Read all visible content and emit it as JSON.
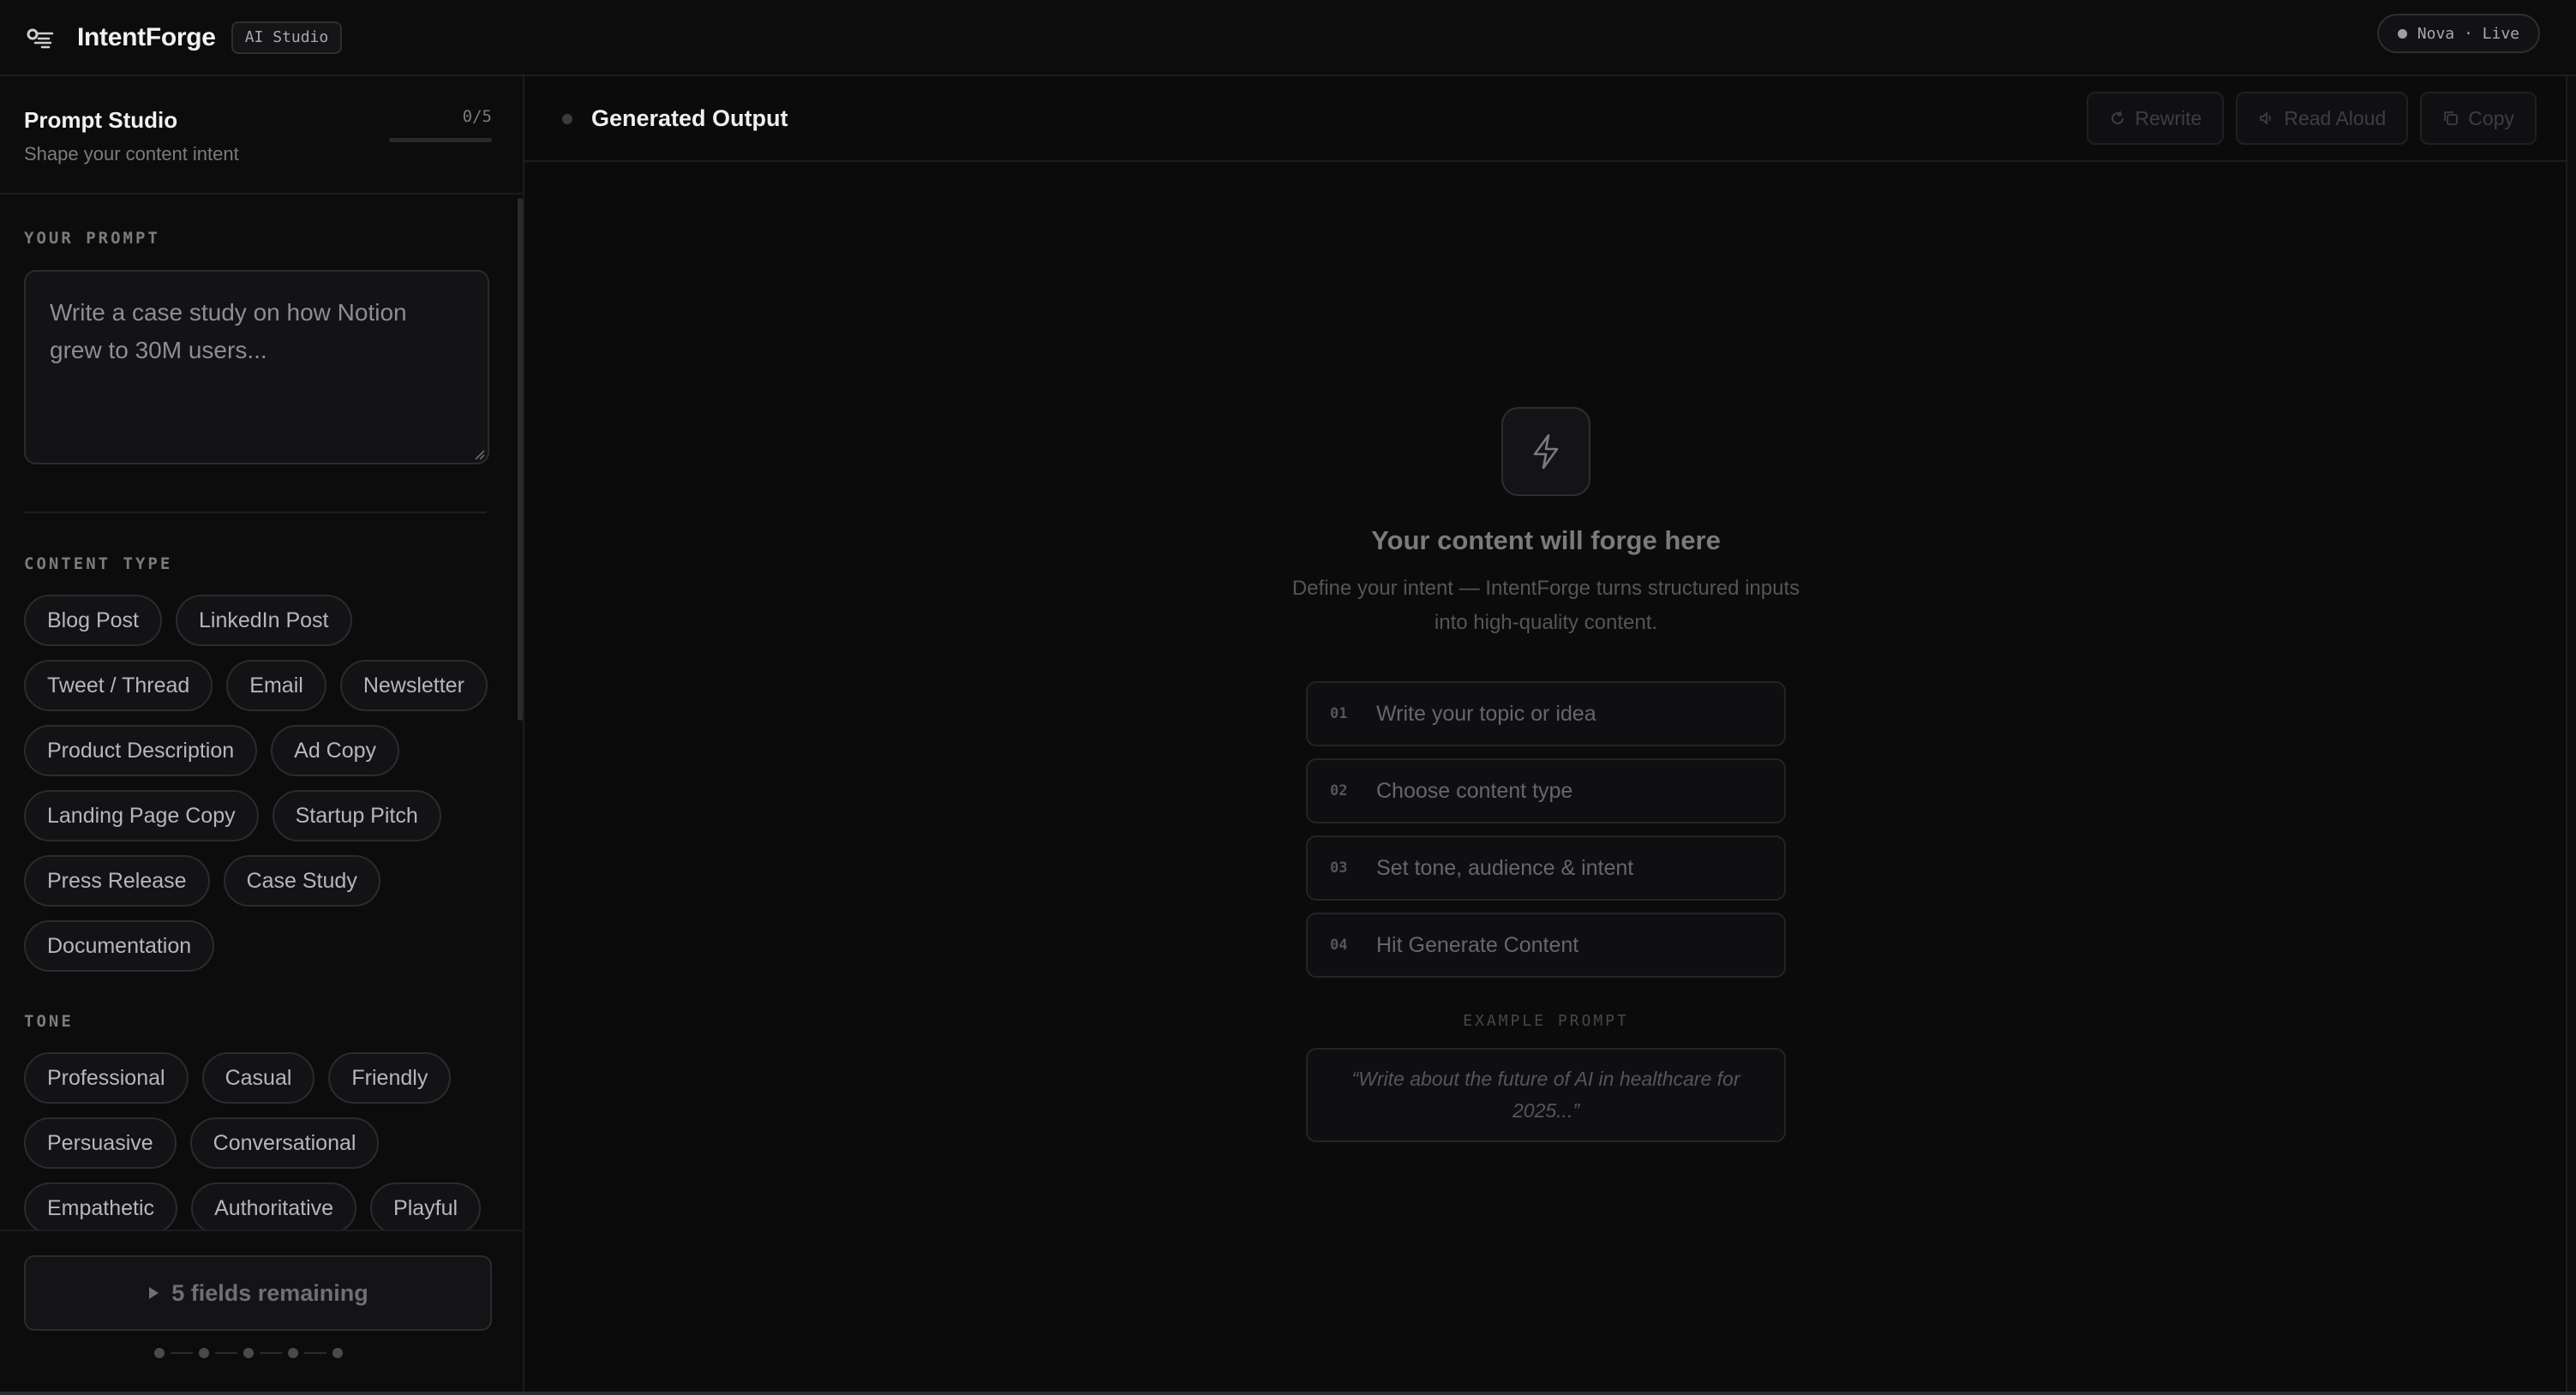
{
  "header": {
    "app_name": "IntentForge",
    "badge": "AI Studio",
    "status": "Nova · Live"
  },
  "sidebar": {
    "title": "Prompt Studio",
    "subtitle": "Shape your content intent",
    "progress_text": "0/5",
    "progress_fraction": 0,
    "prompt_label": "YOUR PROMPT",
    "prompt_placeholder": "Write a case study on how Notion grew to 30M users...",
    "content_type_label": "CONTENT TYPE",
    "content_types": [
      "Blog Post",
      "LinkedIn Post",
      "Tweet / Thread",
      "Email",
      "Newsletter",
      "Product Description",
      "Ad Copy",
      "Landing Page Copy",
      "Startup Pitch",
      "Press Release",
      "Case Study",
      "Documentation"
    ],
    "tone_label": "TONE",
    "tones": [
      "Professional",
      "Casual",
      "Friendly",
      "Persuasive",
      "Conversational",
      "Empathetic",
      "Authoritative",
      "Playful"
    ],
    "generate_label": "5 fields remaining",
    "steps_total": 5
  },
  "output": {
    "title": "Generated Output",
    "actions": [
      "Rewrite",
      "Read Aloud",
      "Copy"
    ],
    "empty_title": "Your content will forge here",
    "empty_desc": "Define your intent — IntentForge turns structured inputs into high-quality content.",
    "guide_steps": [
      {
        "num": "01",
        "text": "Write your topic or idea"
      },
      {
        "num": "02",
        "text": "Choose content type"
      },
      {
        "num": "03",
        "text": "Set tone, audience & intent"
      },
      {
        "num": "04",
        "text": "Hit Generate Content"
      }
    ],
    "example_label": "EXAMPLE PROMPT",
    "example_text": "“Write about the future of AI in healthcare for 2025...”"
  },
  "icons": [
    "logo-icon",
    "lightning-icon",
    "refresh-icon",
    "speaker-icon",
    "copy-icon",
    "play-icon",
    "status-dot-icon"
  ],
  "colors": {
    "background": "#0b0b0c",
    "panel": "#0c0c0d",
    "border": "#2b2b2f",
    "text": "#f2f2f2",
    "muted": "#7b7b80"
  }
}
